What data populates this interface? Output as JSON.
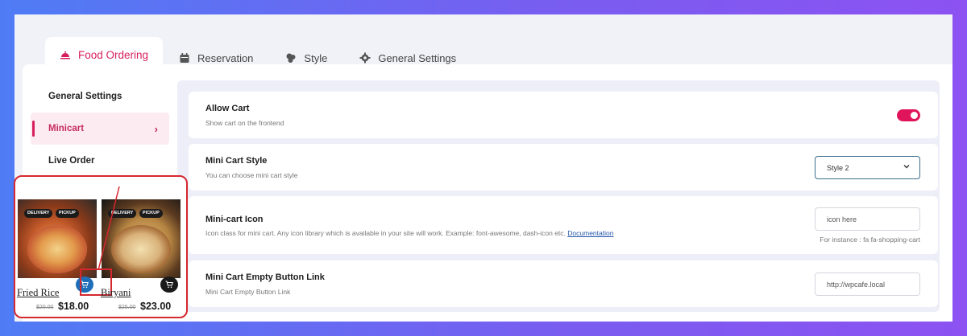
{
  "tabs": [
    {
      "label": "Food Ordering",
      "icon": "cloche-icon",
      "active": true
    },
    {
      "label": "Reservation",
      "icon": "calendar-icon",
      "active": false
    },
    {
      "label": "Style",
      "icon": "palette-icon",
      "active": false
    },
    {
      "label": "General Settings",
      "icon": "gear-icon",
      "active": false
    }
  ],
  "sidebar": {
    "items": [
      {
        "label": "General Settings",
        "active": false
      },
      {
        "label": "Minicart",
        "active": true
      },
      {
        "label": "Live Order",
        "active": false
      }
    ]
  },
  "settings": {
    "allow_cart": {
      "title": "Allow Cart",
      "description": "Show cart on the frontend",
      "enabled": true
    },
    "mini_cart_style": {
      "title": "Mini Cart Style",
      "description": "You can choose mini cart style",
      "selected": "Style 2"
    },
    "mini_cart_icon": {
      "title": "Mini-cart Icon",
      "description": "Icon class for mini cart. Any icon library which is available in your site will work. Example: font-awesome, dash-icon etc.",
      "link_text": "Documentation",
      "placeholder": "icon here",
      "hint": "For instance : fa fa-shopping-cart"
    },
    "empty_button_link": {
      "title": "Mini Cart Empty Button Link",
      "description": "Mini Cart Empty Button Link",
      "value": "http://wpcafe.local"
    }
  },
  "preview": {
    "products": [
      {
        "name": "Fried Rice",
        "old_price": "$20.00",
        "price": "$18.00",
        "badges": [
          "DELIVERY",
          "PICKUP"
        ],
        "cart_color": "#1e6fb8"
      },
      {
        "name": "Biryani",
        "old_price": "$25.00",
        "price": "$23.00",
        "badges": [
          "DELIVERY",
          "PICKUP"
        ],
        "cart_color": "#1a1a1a"
      }
    ]
  },
  "colors": {
    "accent": "#d61f5b",
    "highlight_red": "#d5282e"
  }
}
